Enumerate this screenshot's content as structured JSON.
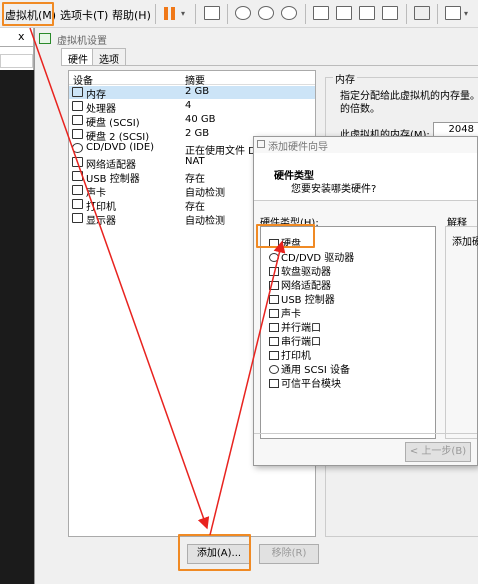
{
  "menu": {
    "vm": "虚拟机(M)",
    "tabs": "选项卡(T)",
    "help": "帮助(H)"
  },
  "left_panel": {
    "close": "x"
  },
  "dialog": {
    "title": "虚拟机设置",
    "tabs": [
      "硬件",
      "选项"
    ],
    "columns": {
      "device": "设备",
      "summary": "摘要"
    },
    "devices": [
      {
        "name": "内存",
        "summary": "2 GB",
        "icon": "memory-icon"
      },
      {
        "name": "处理器",
        "summary": "4",
        "icon": "cpu-icon"
      },
      {
        "name": "硬盘 (SCSI)",
        "summary": "40 GB",
        "icon": "disk-icon"
      },
      {
        "name": "硬盘 2 (SCSI)",
        "summary": "2 GB",
        "icon": "disk-icon"
      },
      {
        "name": "CD/DVD (IDE)",
        "summary": "正在使用文件 D:\\",
        "icon": "cd-icon"
      },
      {
        "name": "网络适配器",
        "summary": "NAT",
        "icon": "network-icon"
      },
      {
        "name": "USB 控制器",
        "summary": "存在",
        "icon": "usb-icon"
      },
      {
        "name": "声卡",
        "summary": "自动检测",
        "icon": "sound-icon"
      },
      {
        "name": "打印机",
        "summary": "存在",
        "icon": "printer-icon"
      },
      {
        "name": "显示器",
        "summary": "自动检测",
        "icon": "display-icon"
      }
    ],
    "add_button": "添加(A)...",
    "remove_button": "移除(R)",
    "memory": {
      "group": "内存",
      "desc1": "指定分配给此虚拟机的内存量。",
      "desc2": "的倍数。",
      "label": "此虚拟机的内存(M):",
      "value": "2048"
    }
  },
  "wizard": {
    "title": "添加硬件向导",
    "heading": "硬件类型",
    "subheading": "您要安装哪类硬件?",
    "types_label": "硬件类型(H):",
    "explain_label": "解释",
    "explain_text": "添加硬",
    "types": [
      "硬盘",
      "CD/DVD 驱动器",
      "软盘驱动器",
      "网络适配器",
      "USB 控制器",
      "声卡",
      "并行端口",
      "串行端口",
      "打印机",
      "通用 SCSI 设备",
      "可信平台模块"
    ],
    "back_button": "< 上一步(B)"
  }
}
